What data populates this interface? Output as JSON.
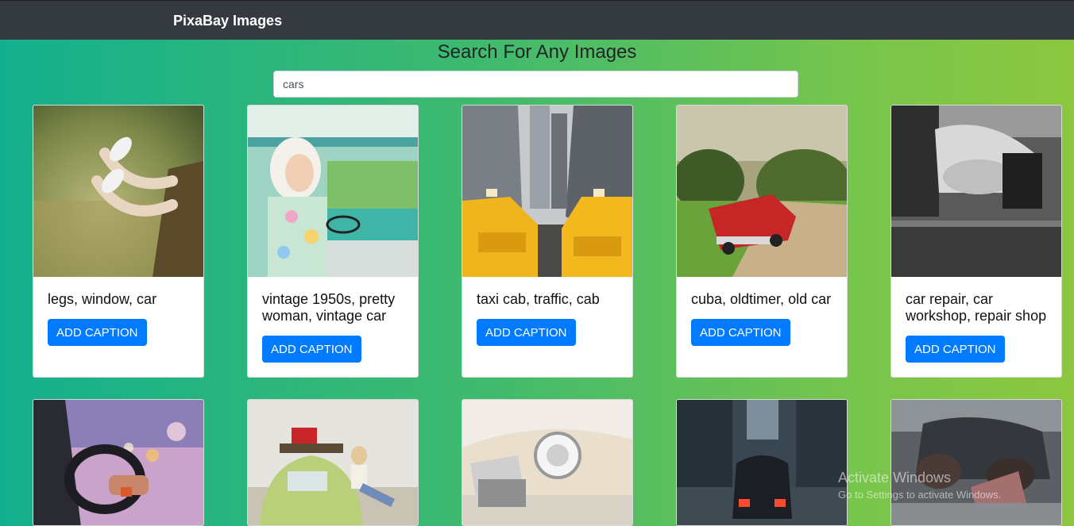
{
  "navbar": {
    "brand": "PixaBay Images"
  },
  "page": {
    "heading": "Search For Any Images"
  },
  "search": {
    "value": "cars"
  },
  "cards": [
    {
      "caption": "legs, window, car",
      "button": "ADD CAPTION"
    },
    {
      "caption": "vintage 1950s, pretty woman, vintage car",
      "button": "ADD CAPTION"
    },
    {
      "caption": "taxi cab, traffic, cab",
      "button": "ADD CAPTION"
    },
    {
      "caption": "cuba, oldtimer, old car",
      "button": "ADD CAPTION"
    },
    {
      "caption": "car repair, car workshop, repair shop",
      "button": "ADD CAPTION"
    }
  ],
  "watermark": {
    "line1": "Activate Windows",
    "line2": "Go to Settings to activate Windows."
  },
  "colors": {
    "navbar": "#343a40",
    "accent": "#007bff",
    "gradient_start": "#14b08e",
    "gradient_end": "#8cc63f"
  }
}
